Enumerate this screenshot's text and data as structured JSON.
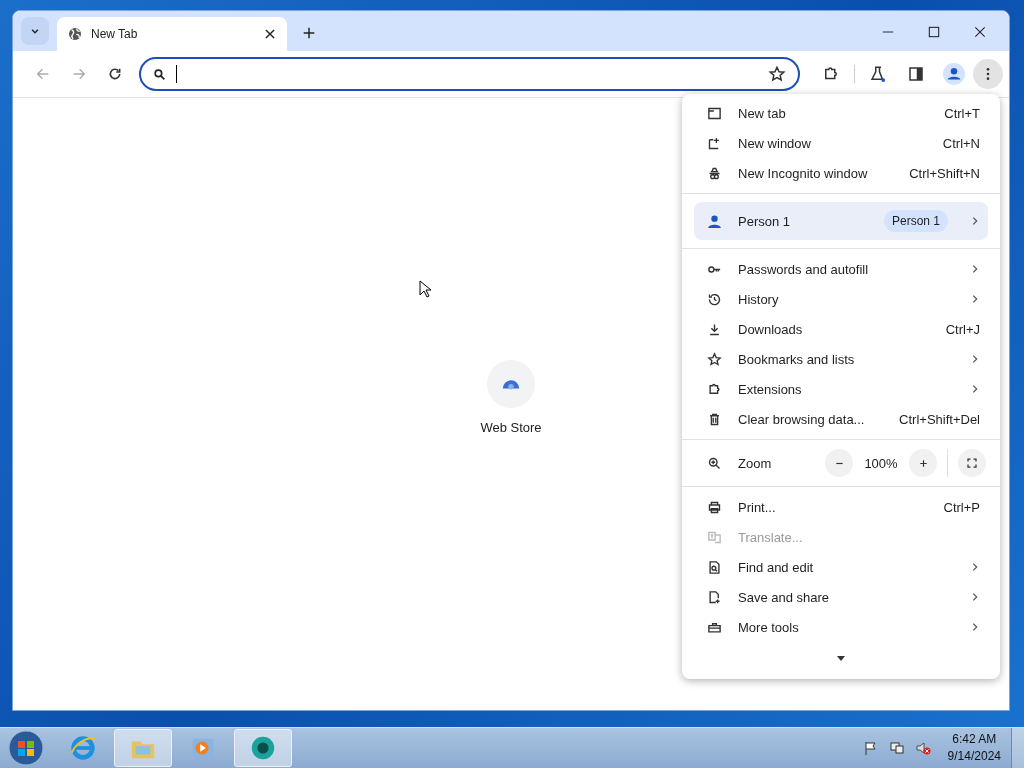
{
  "tabs": [
    {
      "label": "New Tab",
      "selected": true
    }
  ],
  "shortcuts": [
    {
      "label": "Web Store"
    }
  ],
  "menu": {
    "groups": [
      {
        "kind": "items",
        "items": [
          {
            "label": "New tab",
            "shortcut": "Ctrl+T",
            "submenu": false,
            "disabled": false
          },
          {
            "label": "New window",
            "shortcut": "Ctrl+N",
            "submenu": false,
            "disabled": false
          },
          {
            "label": "New Incognito window",
            "shortcut": "Ctrl+Shift+N",
            "submenu": false,
            "disabled": false
          }
        ]
      },
      {
        "kind": "profile",
        "label": "Person 1",
        "badge": "Person 1"
      },
      {
        "kind": "items",
        "items": [
          {
            "label": "Passwords and autofill",
            "submenu": true,
            "disabled": false
          },
          {
            "label": "History",
            "submenu": true,
            "disabled": false
          },
          {
            "label": "Downloads",
            "shortcut": "Ctrl+J",
            "submenu": false,
            "disabled": false
          },
          {
            "label": "Bookmarks and lists",
            "submenu": true,
            "disabled": false
          },
          {
            "label": "Extensions",
            "submenu": true,
            "disabled": false
          },
          {
            "label": "Clear browsing data...",
            "shortcut": "Ctrl+Shift+Del",
            "submenu": false,
            "disabled": false
          }
        ]
      },
      {
        "kind": "zoom",
        "label": "Zoom",
        "value": "100%"
      },
      {
        "kind": "items",
        "items": [
          {
            "label": "Print...",
            "shortcut": "Ctrl+P",
            "submenu": false,
            "disabled": false
          },
          {
            "label": "Translate...",
            "submenu": false,
            "disabled": true
          },
          {
            "label": "Find and edit",
            "submenu": true,
            "disabled": false
          },
          {
            "label": "Save and share",
            "submenu": true,
            "disabled": false
          },
          {
            "label": "More tools",
            "submenu": true,
            "disabled": false
          }
        ]
      }
    ]
  },
  "taskbar": {
    "apps": [
      {
        "selected": false
      },
      {
        "selected": true
      },
      {
        "selected": false
      },
      {
        "selected": true
      }
    ],
    "clock": {
      "time": "6:42 AM",
      "date": "9/14/2024"
    }
  }
}
